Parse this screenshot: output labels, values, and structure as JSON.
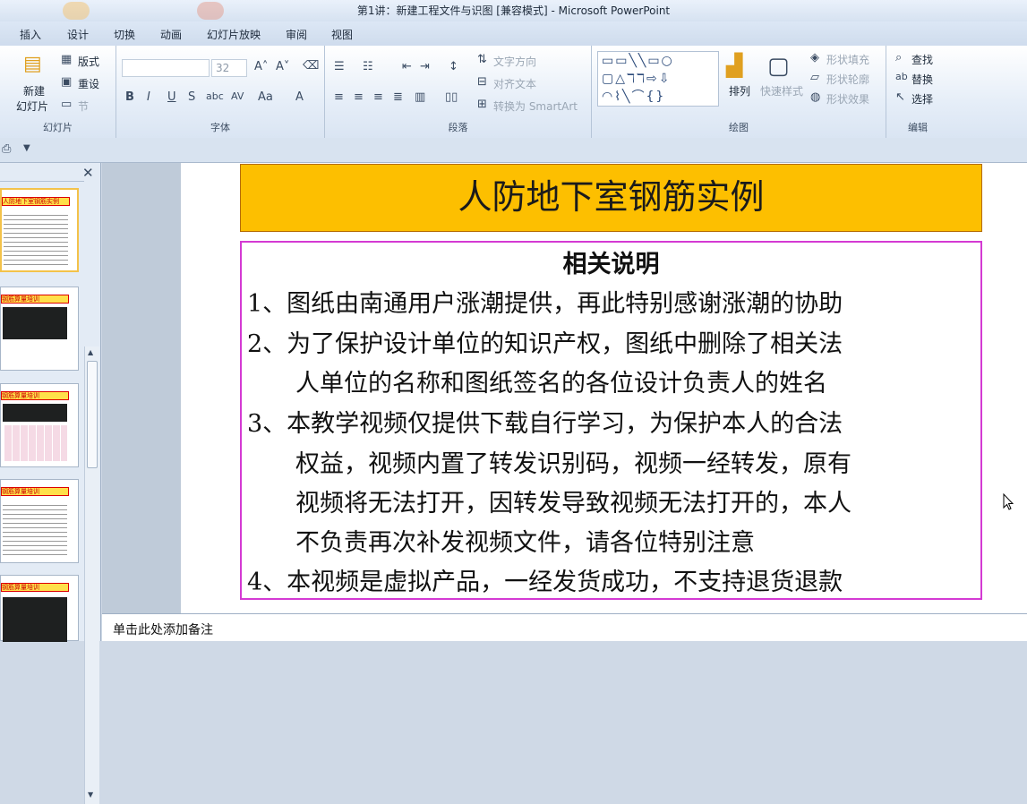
{
  "window": {
    "title": "第1讲：新建工程文件与识图 [兼容模式] - Microsoft PowerPoint"
  },
  "ribbon_tabs": [
    "插入",
    "设计",
    "切换",
    "动画",
    "幻灯片放映",
    "审阅",
    "视图"
  ],
  "ribbon": {
    "slides_group": {
      "label": "幻灯片",
      "new_slide_line1": "新建",
      "new_slide_line2": "幻灯片",
      "layout": "版式",
      "reset": "重设",
      "section": "节"
    },
    "font_group": {
      "label": "字体",
      "font_size": "32"
    },
    "paragraph_group": {
      "label": "段落",
      "text_direction": "文字方向",
      "align_text": "对齐文本",
      "convert_smartart": "转换为 SmartArt"
    },
    "drawing_group": {
      "label": "绘图",
      "arrange": "排列",
      "quick_styles": "快速样式",
      "shape_fill": "形状填充",
      "shape_outline": "形状轮廓",
      "shape_effects": "形状效果"
    },
    "editing_group": {
      "label": "编辑",
      "find": "查找",
      "replace": "替换",
      "select": "选择"
    }
  },
  "thumbnails": [
    {
      "title": "人防地下室钢筋实例",
      "selected": true
    },
    {
      "title": "钢筋算量培训",
      "selected": false
    },
    {
      "title": "钢筋算量培训",
      "selected": false
    },
    {
      "title": "钢筋算量培训",
      "selected": false
    },
    {
      "title": "钢筋算量培训",
      "selected": false
    }
  ],
  "slide": {
    "title": "人防地下室钢筋实例",
    "subtitle": "相关说明",
    "lines": [
      "1、图纸由南通用户涨潮提供，再此特别感谢涨潮的协助",
      "2、为了保护设计单位的知识产权，图纸中删除了相关法",
      "　　人单位的名称和图纸签名的各位设计负责人的姓名",
      "3、本教学视频仅提供下载自行学习，为保护本人的合法",
      "　　权益，视频内置了转发识别码，视频一经转发，原有",
      "　　视频将无法打开，因转发导致视频无法打开的，本人",
      "　　不负责再次补发视频文件，请各位特别注意",
      "4、本视频是虚拟产品，一经发货成功，不支持退货退款"
    ]
  },
  "notes": {
    "placeholder": "单击此处添加备注"
  },
  "colors": {
    "title_fill": "#fdbf00",
    "body_border": "#d43ad3",
    "ribbon_bg": "#dae5f3"
  }
}
